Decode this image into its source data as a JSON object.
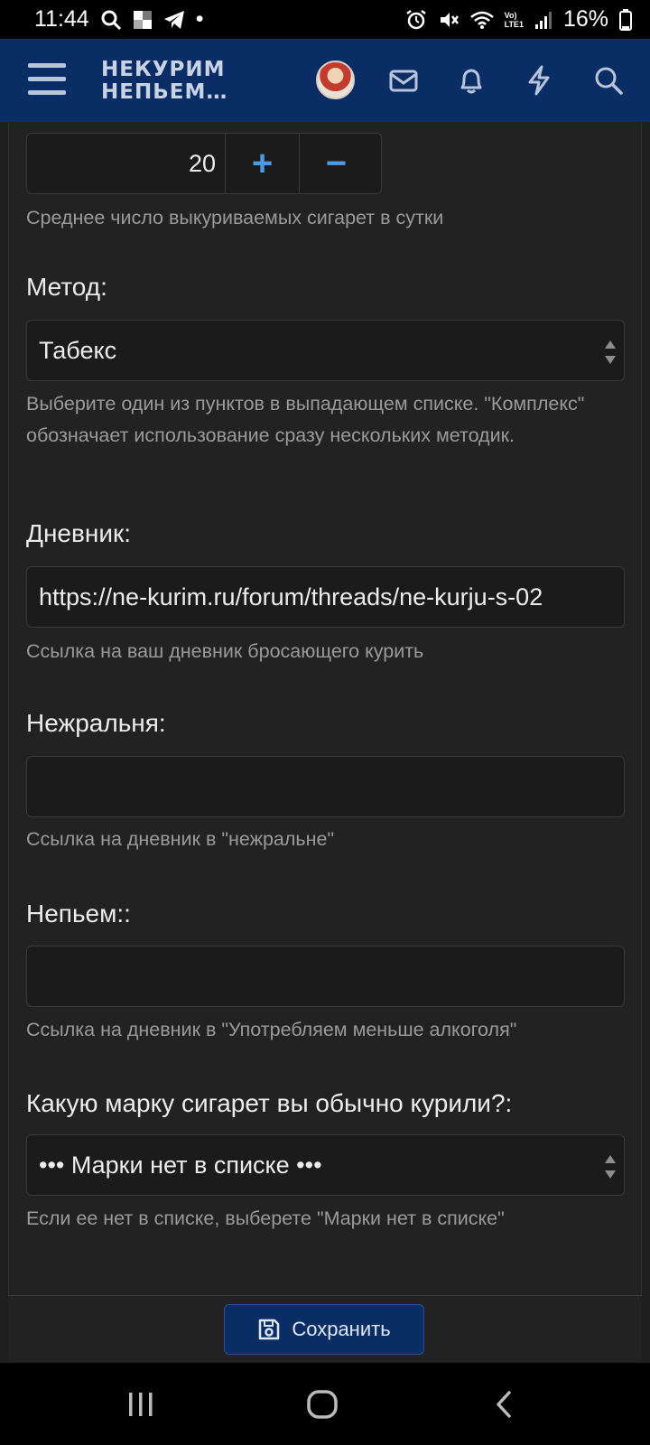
{
  "status_bar": {
    "time": "11:44",
    "dot": "•",
    "signal_label": "Vo)\nLTE1",
    "battery": "16%"
  },
  "header": {
    "logo_line1": "НЕКУРИМ",
    "logo_line2": "НЕПЬЕМ…"
  },
  "form": {
    "cigarettes": {
      "value": "20",
      "plus": "+",
      "minus": "−",
      "hint": "Среднее число выкуриваемых сигарет в сутки"
    },
    "method": {
      "label": "Метод:",
      "value": "Табекс",
      "hint": "Выберите один из пунктов в выпадающем списке. \"Комплекс\" обозначает использование сразу нескольких методик."
    },
    "diary": {
      "label": "Дневник:",
      "value": "https://ne-kurim.ru/forum/threads/ne-kurju-s-02",
      "hint": "Ссылка на ваш дневник бросающего курить"
    },
    "nezhralnya": {
      "label": "Нежральня:",
      "value": "",
      "hint": "Ссылка на дневник в \"нежральне\""
    },
    "nepyem": {
      "label": "Непьем::",
      "value": "",
      "hint": "Ссылка на дневник в \"Употребляем меньше алкоголя\""
    },
    "brand": {
      "label": "Какую марку сигарет вы обычно курили?:",
      "value": "••• Марки нет в списке •••",
      "hint": "Если ее нет в списке, выберете \"Марки нет в списке\""
    }
  },
  "save_label": "Сохранить",
  "colors": {
    "header_bg": "#0b2d66",
    "accent": "#4a9be6",
    "page_bg": "#222222"
  }
}
